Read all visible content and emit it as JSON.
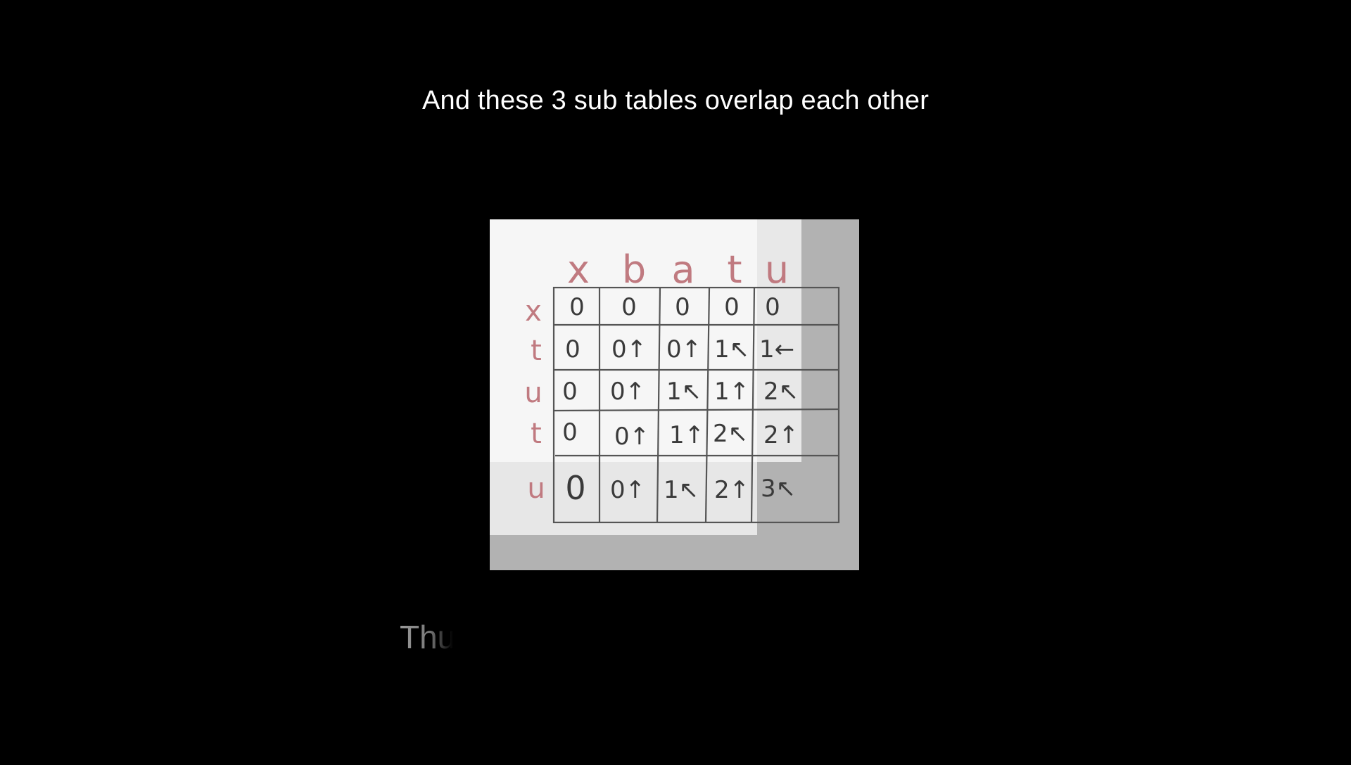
{
  "caption": "And these 3 sub tables overlap each other",
  "next_caption": "Thu",
  "table": {
    "columns": [
      "x",
      "b",
      "a",
      "t",
      "u"
    ],
    "rows": [
      "x",
      "t",
      "u",
      "t",
      "u"
    ],
    "cells": [
      [
        "0",
        "0",
        "0",
        "0",
        "0"
      ],
      [
        "0",
        "0↑",
        "0↑",
        "1↖",
        "1←"
      ],
      [
        "0",
        "0↑",
        "1↖",
        "1↑",
        "2↖"
      ],
      [
        "0",
        "0↑",
        "1↑",
        "2↖",
        "2↑"
      ],
      [
        "0",
        "0↑",
        "1↖",
        "2↑",
        "3↖"
      ]
    ]
  }
}
